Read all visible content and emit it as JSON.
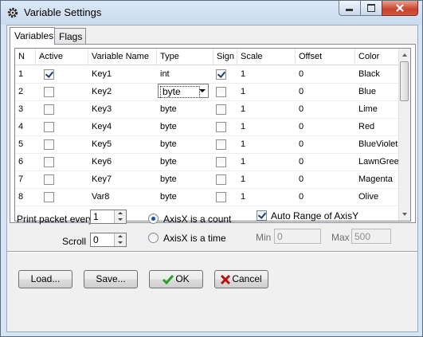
{
  "window": {
    "title": "Variable Settings",
    "icon": "gear-icon"
  },
  "tabs": [
    {
      "label": "Variables"
    },
    {
      "label": "Flags"
    }
  ],
  "grid": {
    "columns": [
      "N",
      "Active",
      "Variable Name",
      "Type",
      "Sign",
      "Scale",
      "Offset",
      "Color"
    ],
    "rows": [
      {
        "n": "1",
        "active": true,
        "name": "Key1",
        "type": "int",
        "sign": true,
        "scale": "1",
        "offset": "0",
        "color": "Black"
      },
      {
        "n": "2",
        "active": false,
        "name": "Key2",
        "type": "byte",
        "sign": false,
        "scale": "1",
        "offset": "0",
        "color": "Blue"
      },
      {
        "n": "3",
        "active": false,
        "name": "Key3",
        "type": "byte",
        "sign": false,
        "scale": "1",
        "offset": "0",
        "color": "Lime"
      },
      {
        "n": "4",
        "active": false,
        "name": "Key4",
        "type": "byte",
        "sign": false,
        "scale": "1",
        "offset": "0",
        "color": "Red"
      },
      {
        "n": "5",
        "active": false,
        "name": "Key5",
        "type": "byte",
        "sign": false,
        "scale": "1",
        "offset": "0",
        "color": "BlueViolet"
      },
      {
        "n": "6",
        "active": false,
        "name": "Key6",
        "type": "byte",
        "sign": false,
        "scale": "1",
        "offset": "0",
        "color": "LawnGreen"
      },
      {
        "n": "7",
        "active": false,
        "name": "Key7",
        "type": "byte",
        "sign": false,
        "scale": "1",
        "offset": "0",
        "color": "Magenta"
      },
      {
        "n": "8",
        "active": false,
        "name": "Var8",
        "type": "byte",
        "sign": false,
        "scale": "1",
        "offset": "0",
        "color": "Olive"
      }
    ]
  },
  "options": {
    "print_label": "Print packet every",
    "print_value": "1",
    "scroll_label": "Scroll",
    "scroll_value": "0",
    "axisx_count_label": "AxisX is a count",
    "axisx_time_label": "AxisX is a time",
    "axisx_mode": "count",
    "auto_range_label": "Auto Range of AxisY",
    "auto_range_checked": true,
    "min_label": "Min",
    "min_value": "0",
    "max_label": "Max",
    "max_value": "500"
  },
  "buttons": {
    "load": "Load...",
    "save": "Save...",
    "ok": "OK",
    "cancel": "Cancel"
  },
  "colors": {
    "ok_icon": "#2a9d2a",
    "cancel_icon": "#b51414"
  }
}
